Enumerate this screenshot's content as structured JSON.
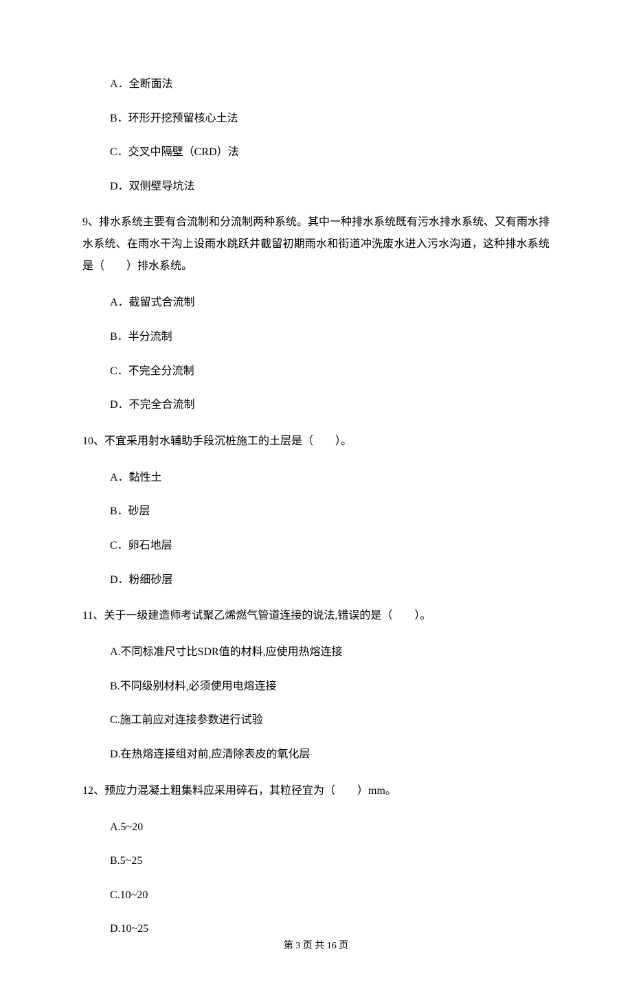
{
  "q8": {
    "options": {
      "a": "A．全断面法",
      "b": "B．环形开挖预留核心土法",
      "c": "C．交叉中隔壁（CRD）法",
      "d": "D．双侧壁导坑法"
    }
  },
  "q9": {
    "text": "9、排水系统主要有合流制和分流制两种系统。其中一种排水系统既有污水排水系统、又有雨水排水系统、在雨水干沟上设雨水跳跃井截留初期雨水和街道冲洗废水进入污水沟道，这种排水系统是（　　）排水系统。",
    "options": {
      "a": "A．截留式合流制",
      "b": "B．半分流制",
      "c": "C．不完全分流制",
      "d": "D．不完全合流制"
    }
  },
  "q10": {
    "text": "10、不宜采用射水辅助手段沉桩施工的土层是（　　）。",
    "options": {
      "a": "A．黏性土",
      "b": "B．砂层",
      "c": "C．卵石地层",
      "d": "D．粉细砂层"
    }
  },
  "q11": {
    "text": "11、关于一级建造师考试聚乙烯燃气管道连接的说法,错误的是（　　）。",
    "options": {
      "a": "A.不同标准尺寸比SDR值的材料,应使用热熔连接",
      "b": "B.不同级别材料,必须使用电熔连接",
      "c": "C.施工前应对连接参数进行试验",
      "d": "D.在热熔连接组对前,应清除表皮的氧化层"
    }
  },
  "q12": {
    "text": "12、预应力混凝土粗集料应采用碎石，其粒径宜为（　　）mm。",
    "options": {
      "a": "A.5~20",
      "b": "B.5~25",
      "c": "C.10~20",
      "d": "D.10~25"
    }
  },
  "footer": "第 3 页 共 16 页"
}
